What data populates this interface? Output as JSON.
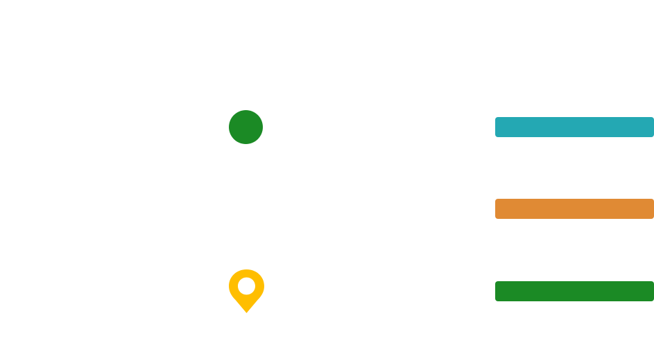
{
  "markers": {
    "dot": {
      "icon": "filled-circle-marker-icon",
      "color": "#1b8a25"
    },
    "pin": {
      "icon": "map-pin-icon",
      "color": "#ffbe00"
    }
  },
  "bars": [
    {
      "color": "#24a8b3"
    },
    {
      "color": "#e08a34"
    },
    {
      "color": "#1b8a25"
    }
  ]
}
